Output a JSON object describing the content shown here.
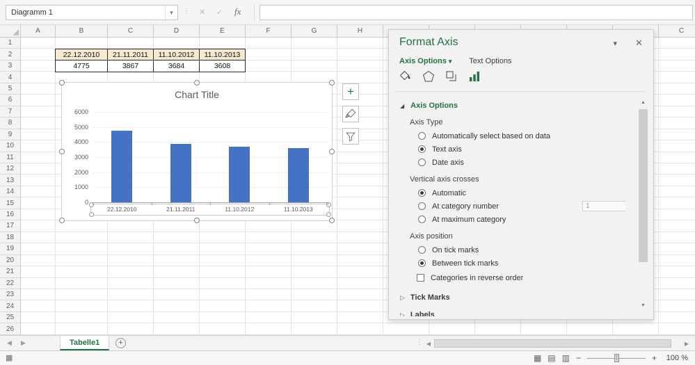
{
  "top": {
    "name_box": "Diagramm 1",
    "formula_value": ""
  },
  "icons": {
    "dropdown": "▾",
    "dots": "⋮",
    "cancel": "✕",
    "enter": "✓",
    "fx": "fx",
    "close": "✕",
    "left_arrow": "◀",
    "right_arrow": "▶",
    "up_arrow": "▲",
    "down_arrow": "▼",
    "expanded": "◢",
    "collapsed": "▷",
    "minus": "−",
    "plus": "+",
    "view_normal": "▦",
    "view_layout": "▤",
    "view_break": "▥",
    "macro": "▦",
    "chart_elements": "+"
  },
  "grid": {
    "columns": [
      "A",
      "B",
      "C",
      "D",
      "E",
      "F",
      "G",
      "H"
    ],
    "right_column": "C",
    "row_start": 1,
    "row_end": 26,
    "cells": {
      "dates": [
        "22.12.2010",
        "21.11.2011",
        "11.10.2012",
        "11.10.2013"
      ],
      "values": [
        "4775",
        "3867",
        "3684",
        "3608"
      ],
      "date_fill": "#F6E9CE"
    }
  },
  "chart_data": {
    "type": "bar",
    "title": "Chart Title",
    "categories": [
      "22.12.2010",
      "21.11.2011",
      "11.10.2012",
      "11.10.2013"
    ],
    "values": [
      4775,
      3867,
      3684,
      3608
    ],
    "ylim": [
      0,
      6000
    ],
    "yticks": [
      0,
      1000,
      2000,
      3000,
      4000,
      5000,
      6000
    ],
    "bar_color": "#4472C4",
    "legend": "none",
    "gridlines": true
  },
  "format_pane": {
    "title": "Format Axis",
    "accent": "#217346",
    "tabs": [
      {
        "label": "Axis Options",
        "active": true
      },
      {
        "label": "Text Options",
        "active": false
      }
    ],
    "icon_tabs": [
      "fill-line",
      "effects",
      "size-properties",
      "axis-options"
    ],
    "axis_options_header": "Axis Options",
    "groups": [
      {
        "label": "Axis Type",
        "options": [
          {
            "label": "Automatically select based on data",
            "selected": false
          },
          {
            "label": "Text axis",
            "selected": true
          },
          {
            "label": "Date axis",
            "selected": false
          }
        ]
      },
      {
        "label": "Vertical axis crosses",
        "options": [
          {
            "label": "Automatic",
            "selected": true
          },
          {
            "label": "At category number",
            "selected": false,
            "value": "1"
          },
          {
            "label": "At maximum category",
            "selected": false
          }
        ]
      },
      {
        "label": "Axis position",
        "options": [
          {
            "label": "On tick marks",
            "selected": false
          },
          {
            "label": "Between tick marks",
            "selected": true
          }
        ]
      }
    ],
    "checkbox": {
      "label": "Categories in reverse order",
      "checked": false
    },
    "collapsed_sections": [
      "Tick Marks",
      "Labels"
    ]
  },
  "sheet_bar": {
    "tabs": [
      {
        "label": "Tabelle1",
        "active": true
      }
    ]
  },
  "status_bar": {
    "zoom_label": "100 %"
  }
}
